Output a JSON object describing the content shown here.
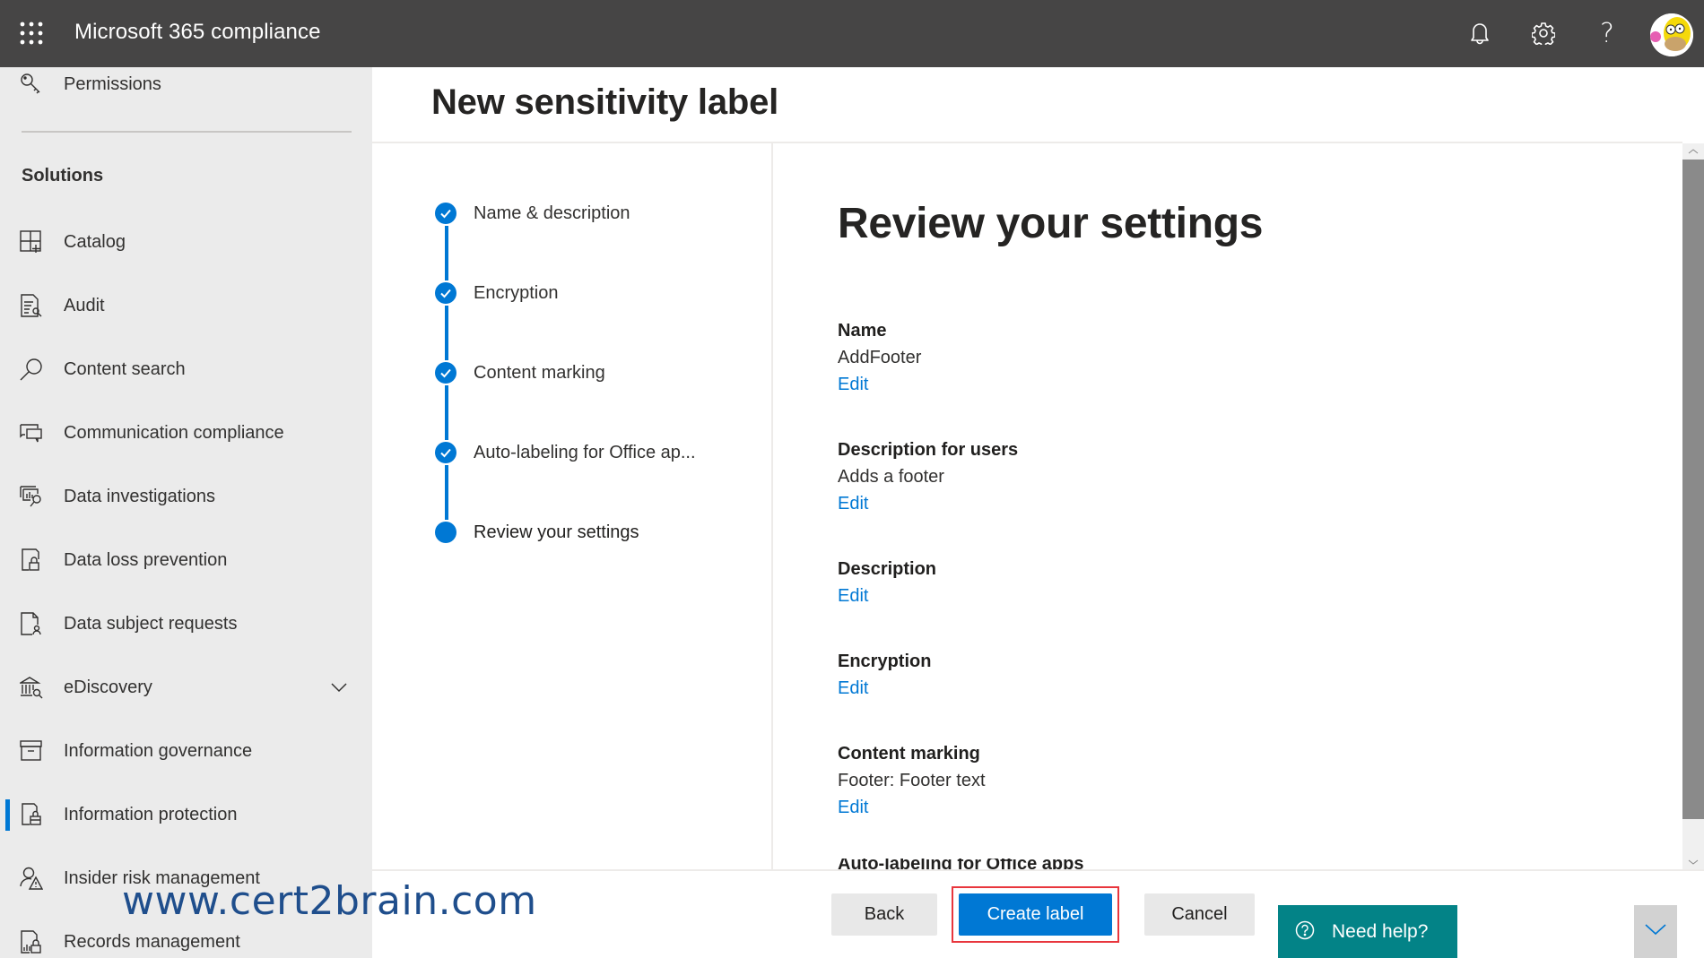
{
  "header": {
    "app_title": "Microsoft 365 compliance",
    "icons": [
      "app-launcher-icon",
      "bell-icon",
      "gear-icon",
      "help-icon",
      "user-avatar"
    ],
    "help_glyph": "?"
  },
  "sidebar": {
    "top_items": [
      {
        "label": "Permissions",
        "icon": "key-icon"
      }
    ],
    "section_label": "Solutions",
    "items": [
      {
        "label": "Catalog",
        "icon": "catalog-icon"
      },
      {
        "label": "Audit",
        "icon": "audit-icon"
      },
      {
        "label": "Content search",
        "icon": "search-icon"
      },
      {
        "label": "Communication compliance",
        "icon": "chat-icon"
      },
      {
        "label": "Data investigations",
        "icon": "data-investigation-icon"
      },
      {
        "label": "Data loss prevention",
        "icon": "lock-document-icon"
      },
      {
        "label": "Data subject requests",
        "icon": "person-document-icon"
      },
      {
        "label": "eDiscovery",
        "icon": "courthouse-icon",
        "expandable": true
      },
      {
        "label": "Information governance",
        "icon": "archive-icon"
      },
      {
        "label": "Information protection",
        "icon": "shield-document-icon",
        "active": true
      },
      {
        "label": "Insider risk management",
        "icon": "person-warning-icon"
      },
      {
        "label": "Records management",
        "icon": "records-icon"
      }
    ]
  },
  "page": {
    "title": "New sensitivity label"
  },
  "wizard": {
    "steps": [
      {
        "label": "Name & description",
        "state": "completed"
      },
      {
        "label": "Encryption",
        "state": "completed"
      },
      {
        "label": "Content marking",
        "state": "completed"
      },
      {
        "label": "Auto-labeling for Office ap...",
        "state": "completed"
      },
      {
        "label": "Review your settings",
        "state": "current"
      }
    ]
  },
  "review": {
    "title": "Review your settings",
    "edit_label": "Edit",
    "sections": [
      {
        "heading": "Name",
        "value": "AddFooter"
      },
      {
        "heading": "Description for users",
        "value": "Adds a footer"
      },
      {
        "heading": "Description",
        "value": null
      },
      {
        "heading": "Encryption",
        "value": null
      },
      {
        "heading": "Content marking",
        "value": "Footer: Footer text"
      }
    ],
    "clipped_heading": "Auto-labeling for Office apps"
  },
  "footer": {
    "back_label": "Back",
    "create_label": "Create label",
    "cancel_label": "Cancel",
    "need_help_label": "Need help?"
  },
  "colors": {
    "header_bg": "#464545",
    "sidebar_bg": "#ebebeb",
    "accent": "#0078d4",
    "help_button": "#038387",
    "highlight": "#e8363d"
  },
  "watermark": "www.cert2brain.com"
}
